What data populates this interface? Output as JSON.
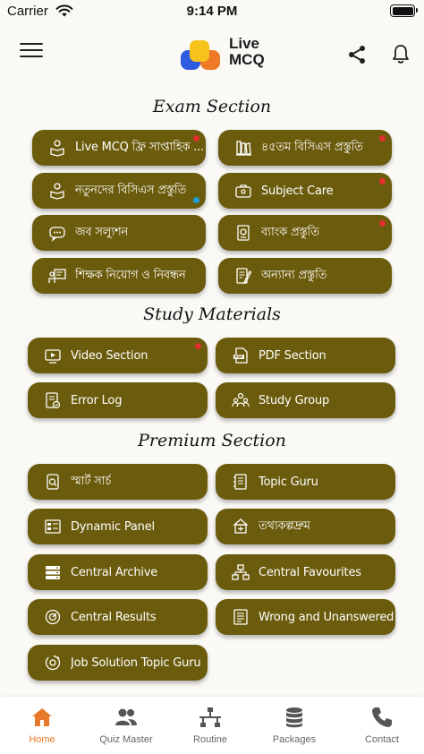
{
  "status_bar": {
    "carrier": "Carrier",
    "time": "9:14 PM"
  },
  "app": {
    "logo_line1": "Live",
    "logo_line2": "MCQ"
  },
  "sections": {
    "exam": {
      "title": "Exam Section",
      "items": [
        {
          "label": "Live MCQ ফ্রি সাপ্তাহিক ...",
          "icon": "person-reading-icon",
          "badge": "red"
        },
        {
          "label": "৪৫তম বিসিএস প্রস্তুতি",
          "icon": "books-stack-icon",
          "badge": "red"
        },
        {
          "label": "নতুনদের বিসিএস প্রস্তুতি",
          "icon": "person-reading-icon",
          "badge": "blue"
        },
        {
          "label": "Subject Care",
          "icon": "briefcase-icon",
          "badge": "red"
        },
        {
          "label": "জব সল্যুশন",
          "icon": "chat-bubble-icon",
          "badge": ""
        },
        {
          "label": "ব্যাংক প্রস্তুতি",
          "icon": "bank-icon",
          "badge": "red"
        },
        {
          "label": "শিক্ষক নিয়োগ ও নিবন্ধন",
          "icon": "teacher-board-icon",
          "badge": ""
        },
        {
          "label": "অন্যান্য প্রস্তুতি",
          "icon": "clipboard-pen-icon",
          "badge": ""
        }
      ]
    },
    "study": {
      "title": "Study Materials",
      "items": [
        {
          "label": "Video Section",
          "icon": "video-play-icon",
          "badge": "red"
        },
        {
          "label": "PDF Section",
          "icon": "pdf-file-icon",
          "badge": ""
        },
        {
          "label": "Error Log",
          "icon": "error-log-icon",
          "badge": ""
        },
        {
          "label": "Study Group",
          "icon": "group-icon",
          "badge": ""
        }
      ]
    },
    "premium": {
      "title": "Premium Section",
      "items": [
        {
          "label": "স্মার্ট সার্চ",
          "icon": "smart-search-icon",
          "badge": ""
        },
        {
          "label": "Topic Guru",
          "icon": "topic-book-icon",
          "badge": ""
        },
        {
          "label": "Dynamic Panel",
          "icon": "panel-icon",
          "badge": ""
        },
        {
          "label": "তথ্যকল্পদ্রুম",
          "icon": "info-tree-icon",
          "badge": ""
        },
        {
          "label": "Central Archive",
          "icon": "archive-server-icon",
          "badge": ""
        },
        {
          "label": "Central Favourites",
          "icon": "hierarchy-icon",
          "badge": ""
        },
        {
          "label": "Central Results",
          "icon": "results-gauge-icon",
          "badge": ""
        },
        {
          "label": "Wrong and Unanswered",
          "icon": "list-check-icon",
          "badge": ""
        },
        {
          "label": "Job Solution Topic Guru",
          "icon": "topic-circle-icon",
          "badge": ""
        }
      ]
    }
  },
  "tabs": [
    {
      "label": "Home",
      "icon": "home-icon",
      "active": true
    },
    {
      "label": "Quiz Master",
      "icon": "users-icon",
      "active": false
    },
    {
      "label": "Routine",
      "icon": "routine-network-icon",
      "active": false
    },
    {
      "label": "Packages",
      "icon": "database-icon",
      "active": false
    },
    {
      "label": "Contact",
      "icon": "phone-icon",
      "active": false
    }
  ],
  "colors": {
    "button_bg": "#6b5b0c",
    "accent": "#e8792b",
    "badge_red": "#e0312c",
    "badge_blue": "#1f9bd6"
  }
}
